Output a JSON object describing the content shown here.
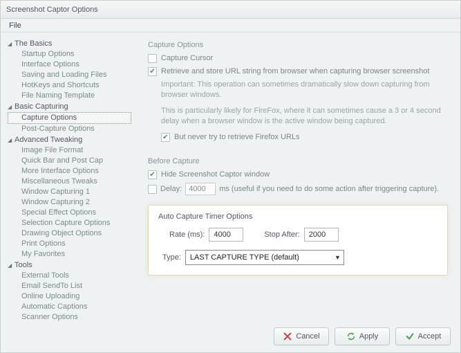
{
  "title": "Screenshot Captor Options",
  "menu": {
    "file": "File"
  },
  "sidebar": {
    "groups": [
      {
        "label": "The Basics",
        "items": [
          "Startup Options",
          "Interface Options",
          "Saving and Loading Files",
          "HotKeys and Shortcuts",
          "File Naming Template"
        ]
      },
      {
        "label": "Basic Capturing",
        "items": [
          "Capture Options",
          "Post-Capture Options"
        ]
      },
      {
        "label": "Advanced Tweaking",
        "items": [
          "Image File Format",
          "Quick Bar and Post Cap",
          "More Interface Options",
          "Miscellaneous Tweaks",
          "Window Capturing 1",
          "Window Capturing 2",
          "Special Effect Options",
          "Selection Capture Options",
          "Drawing Object Options",
          "Print Options",
          "My Favorites"
        ]
      },
      {
        "label": "Tools",
        "items": [
          "External Tools",
          "Email SendTo List",
          "Online Uploading",
          "Automatic Captions",
          "Scanner Options"
        ]
      }
    ],
    "selected": "Capture Options"
  },
  "capture": {
    "heading": "Capture Options",
    "cursor": "Capture Cursor",
    "url": "Retrieve and store URL string from browser when capturing browser screenshot",
    "note1": "Important: This operation can sometimes dramatically slow down capturing from browser windows.",
    "note2": "This is particularly likely for FireFox, where it can sometimes cause a 3  or 4 second delay when a browser window is the active window being captured.",
    "firefox": "But never try to retrieve Firefox URLs"
  },
  "before": {
    "heading": "Before Capture",
    "hide": "Hide Screenshot Captor window",
    "delay_label": "Delay:",
    "delay_value": "4000",
    "delay_suffix": "ms    (useful if you need to do some action after triggering capture)."
  },
  "auto": {
    "heading": "Auto Capture Timer Options",
    "rate_label": "Rate (ms):",
    "rate_value": "4000",
    "stop_label": "Stop After:",
    "stop_value": "2000",
    "type_label": "Type:",
    "type_value": "LAST CAPTURE TYPE (default)"
  },
  "buttons": {
    "cancel": "Cancel",
    "apply": "Apply",
    "accept": "Accept"
  }
}
